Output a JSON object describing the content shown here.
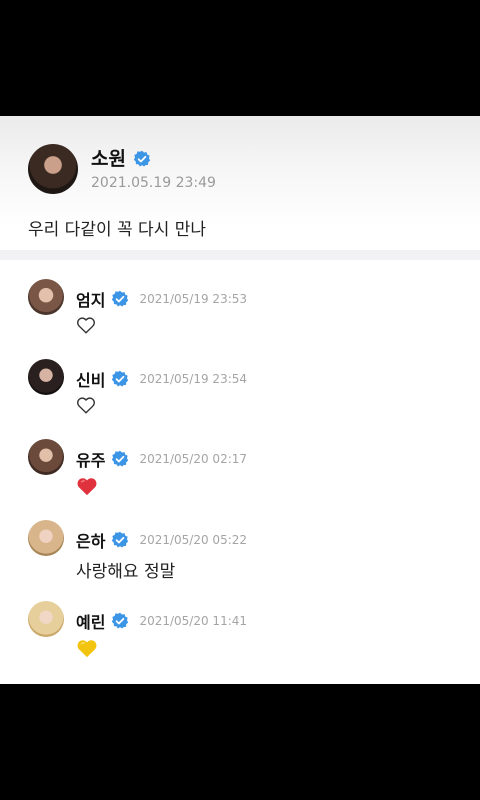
{
  "post": {
    "author": "소원",
    "timestamp": "2021.05.19 23:49",
    "text": "우리 다같이 꼭 다시 만나"
  },
  "comments": [
    {
      "author": "엄지",
      "timestamp": "2021/05/19 23:53",
      "content_icon": "outline-heart-icon",
      "avatar_color": "#c79b86"
    },
    {
      "author": "신비",
      "timestamp": "2021/05/19 23:54",
      "content_icon": "outline-heart-icon",
      "avatar_color": "#2b2020"
    },
    {
      "author": "유주",
      "timestamp": "2021/05/20 02:17",
      "content_icon": "red-heart-icon",
      "avatar_color": "#6b4a3c"
    },
    {
      "author": "은하",
      "timestamp": "2021/05/20 05:22",
      "text": "사랑해요 정말",
      "avatar_color": "#d8b58a"
    },
    {
      "author": "예린",
      "timestamp": "2021/05/20 11:41",
      "content_icon": "yellow-heart-icon",
      "avatar_color": "#e7cf9c"
    }
  ],
  "colors": {
    "verified_badge": "#3d95e6",
    "red_heart": "#e0323c",
    "yellow_heart": "#f2c40f"
  }
}
